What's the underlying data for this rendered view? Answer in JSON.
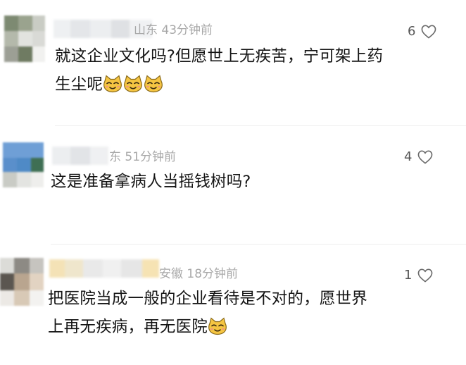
{
  "comments": [
    {
      "location_time": "山东 43分钟前",
      "likes": "6",
      "lines": [
        "就这企业文化吗?但愿世上无疾苦，宁可架上药",
        "生尘呢"
      ],
      "emoji_count": 3
    },
    {
      "location_time": "东 51分钟前",
      "likes": "4",
      "lines": [
        "这是准备拿病人当摇钱树吗?"
      ],
      "emoji_count": 0
    },
    {
      "location_time": "安徽 18分钟前",
      "likes": "1",
      "lines": [
        "把医院当成一般的企业看待是不对的，愿世界",
        "上再无疾病，再无医院"
      ],
      "emoji_count": 1
    }
  ],
  "icons": {
    "like": "heart-outline-icon",
    "emoji": "cat-face-emoji-icon"
  },
  "colors": {
    "meta_text": "#a8a8a8",
    "body_text": "#141414",
    "heart_stroke": "#6a6a6a"
  }
}
